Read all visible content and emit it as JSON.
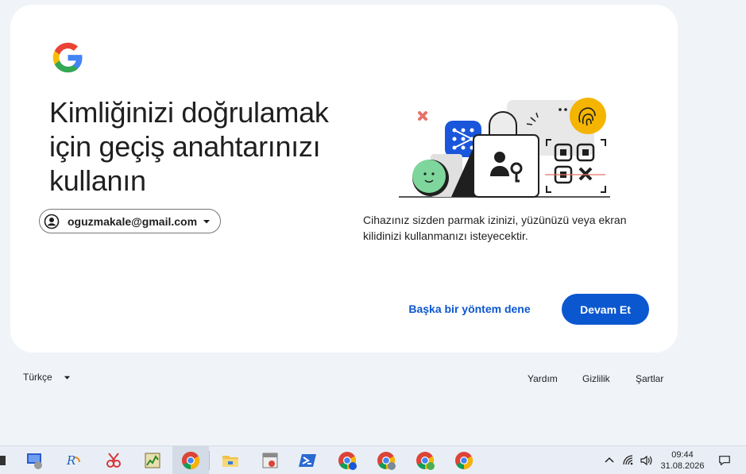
{
  "card": {
    "heading_lines": [
      "Kimliğinizi doğrulamak",
      "için geçiş anahtarınızı",
      "kullanın"
    ],
    "account_email": "oguzmakale@gmail.com",
    "description": "Cihazınız sizden parmak izinizi, yüzünüzü veya ekran kilidinizi kullanmanızı isteyecektir.",
    "try_another_label": "Başka bir yöntem dene",
    "continue_label": "Devam Et"
  },
  "footer": {
    "language": "Türkçe",
    "help": "Yardım",
    "privacy": "Gizlilik",
    "terms": "Şartlar"
  },
  "taskbar": {
    "time": "09:44",
    "date": "31.08.2026",
    "apps": [
      "app-icon",
      "remote-desktop-icon",
      "rdp-client-icon",
      "snipping-tool-icon",
      "task-manager-icon",
      "chrome-icon",
      "file-explorer-icon",
      "window-manager-icon",
      "powershell-icon",
      "chrome-profile-b-icon",
      "chrome-profile-g-icon",
      "chrome-profile-c-icon",
      "chrome-icon"
    ]
  },
  "colors": {
    "accent": "#0b57d0",
    "background": "#f0f4f9",
    "card": "#ffffff"
  }
}
